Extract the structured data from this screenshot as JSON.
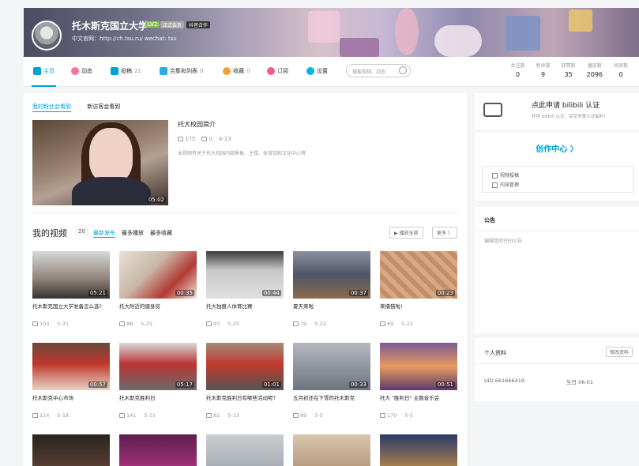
{
  "profile": {
    "name": "托木斯克国立大学",
    "level": "LV2",
    "badge1": "正式会员",
    "badge2": "抖音合作",
    "site": "中文官网：http://ch.tsu.ru/  wechat: tsu"
  },
  "nav": {
    "items": [
      {
        "label": "主页",
        "count": "",
        "icon": "home-icon",
        "color": "#00a1d6"
      },
      {
        "label": "动态",
        "count": "",
        "icon": "dynamic-icon",
        "color": "#fb7299"
      },
      {
        "label": "投稿",
        "count": "21",
        "icon": "upload-icon",
        "color": "#00a1d6"
      },
      {
        "label": "合集和列表",
        "count": "0",
        "icon": "collection-icon",
        "color": "#23ade5"
      },
      {
        "label": "收藏",
        "count": "0",
        "icon": "favorite-icon",
        "color": "#f3a034"
      },
      {
        "label": "订阅",
        "count": "",
        "icon": "subscribe-icon",
        "color": "#f25d8e"
      },
      {
        "label": "设置",
        "count": "",
        "icon": "settings-icon",
        "color": "#00b5e5"
      }
    ],
    "search_placeholder": "搜索视频、动态",
    "stats": [
      {
        "label": "关注数",
        "value": "0"
      },
      {
        "label": "粉丝数",
        "value": "9"
      },
      {
        "label": "获赞数",
        "value": "35"
      },
      {
        "label": "播放数",
        "value": "2096"
      },
      {
        "label": "阅读数",
        "value": "0"
      }
    ]
  },
  "featured": {
    "tab1": "我的粉丝会看到",
    "tab2": "新访客会看到",
    "title": "托大校园简介",
    "plays": "175",
    "comments": "0",
    "date": "4-13",
    "duration": "05:02",
    "desc": "本视频有关于托大校园内部景象、主楼、体育馆和文化中心等"
  },
  "videos": {
    "title": "我的视频",
    "count": "20",
    "sort": [
      "最新发布",
      "最多播放",
      "最多收藏"
    ],
    "play_all": "▶ 播放全部",
    "more": "更多 〉",
    "items": [
      {
        "title": "托木斯克国立大学准备怎么选?",
        "duration": "05:21",
        "plays": "103",
        "date": "5-31",
        "bg": "linear-gradient(180deg,#d9d9d9,#8d8077 60%,#333 100%)"
      },
      {
        "title": "托大附近的健身房",
        "duration": "00:35",
        "plays": "88",
        "date": "5-25",
        "bg": "linear-gradient(135deg,#e7dfd5,#c9b8a8 40%,#b33a35 70%,#f0e6dc)"
      },
      {
        "title": "托大独痕人体育比赛",
        "duration": "00:44",
        "plays": "93",
        "date": "5-25",
        "bg": "linear-gradient(180deg,#3a3a3a,#c8c8c8 40%,#e0e0e0)"
      },
      {
        "title": "夏天来啦",
        "duration": "00:37",
        "plays": "79",
        "date": "5-22",
        "bg": "linear-gradient(180deg,#8890a0,#505566 50%,#8a6b4f)"
      },
      {
        "title": "来撸猫啦!",
        "duration": "00:23",
        "plays": "89",
        "date": "5-22",
        "bg": "repeating-linear-gradient(45deg,#d6a885 0 6px,#c48d66 6px 12px)"
      },
      {
        "title": "托木斯克中心市场",
        "duration": "00:57",
        "plays": "114",
        "date": "5-18",
        "bg": "linear-gradient(180deg,#6a4a3c,#c0392b 45%,#e7d3c4)"
      },
      {
        "title": "托木斯克胜利日",
        "duration": "05:17",
        "plays": "141",
        "date": "5-15",
        "bg": "linear-gradient(180deg,#d8d8d8,#b33 45%,#6b6b6b)"
      },
      {
        "title": "托木斯克胜利日有哪些活动呢?",
        "duration": "01:01",
        "plays": "82",
        "date": "5-13",
        "bg": "linear-gradient(180deg,#a58a7a,#c0392b 45%,#555)"
      },
      {
        "title": "五月初还在下雪的托木斯克",
        "duration": "00:33",
        "plays": "89",
        "date": "5-5",
        "bg": "linear-gradient(180deg,#b5b8bf,#8a8f98 60%,#6e7480)"
      },
      {
        "title": "托大 \"胜利日\" 主题音乐会",
        "duration": "00:51",
        "plays": "170",
        "date": "5-5",
        "bg": "linear-gradient(180deg,#7c5a94,#e89a5e 50%,#5b3a6e)"
      },
      {
        "title": "",
        "duration": "",
        "plays": "",
        "date": "",
        "bg": "linear-gradient(180deg,#2a2420,#6b4a3a)"
      },
      {
        "title": "",
        "duration": "",
        "plays": "",
        "date": "",
        "bg": "linear-gradient(180deg,#5b1f4f,#c23a8a)"
      },
      {
        "title": "",
        "duration": "",
        "plays": "",
        "date": "",
        "bg": "linear-gradient(180deg,#c9cdd2,#9aa0a6)"
      },
      {
        "title": "",
        "duration": "",
        "plays": "",
        "date": "",
        "bg": "linear-gradient(180deg,#d9c6b0,#a98a6a)"
      },
      {
        "title": "",
        "duration": "",
        "plays": "",
        "date": "",
        "bg": "linear-gradient(180deg,#2a3a6a,#e0a040)"
      }
    ]
  },
  "side": {
    "auth_title": "点此申请 bilibili 认证",
    "auth_sub": "获得 bilibili 认证，享受多重认证福利!",
    "creator": "创作中心 〉",
    "creator_l1": "视频投稿",
    "creator_l2": "内容管理",
    "notice_title": "公告",
    "notice_text": "编辑我的空间公告",
    "info_title": "个人资料",
    "info_edit": "修改资料",
    "uid": "UID  661666419",
    "birthday": "生日  06-01"
  }
}
